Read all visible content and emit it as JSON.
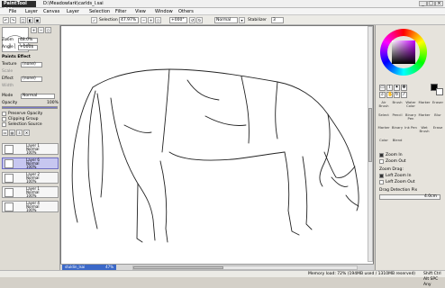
{
  "app": {
    "logo": "PaintTool SAI",
    "title": "D:\\Meadowlark\\carlds_l.sai"
  },
  "window_buttons": {
    "minimize": "_",
    "maximize": "□",
    "close": "×"
  },
  "menu": [
    "File",
    "Layer",
    "Canvas",
    "Layer",
    "Selection",
    "Filter",
    "View",
    "Window",
    "Others"
  ],
  "toolbar": {
    "selection_label": "Selection",
    "zoom": "47.97%",
    "rotate": "+000°",
    "mode": "Normal",
    "stabilizer_label": "Stabilizer",
    "stabilizer_value": "3"
  },
  "left_panel": {
    "zoom_label": "Zoom",
    "zoom_value": "48.0%",
    "angle_label": "Angle",
    "angle_value": "+000$",
    "paints_effect": "Paints Effect",
    "texture_label": "Texture",
    "texture_value": "(none)",
    "scale_label": "Scale",
    "effect_label": "Effect",
    "effect_value": "(none)",
    "width_label": "Width",
    "mode_label": "Mode",
    "mode_value": "Normal",
    "opacity_label": "Opacity",
    "opacity_value": "100%",
    "preserve_opacity": "Preserve Opacity",
    "clipping_group": "Clipping Group",
    "selection_source": "Selection Source",
    "layers": [
      {
        "name": "Layer 1",
        "mode": "Normal",
        "opacity": "100%"
      },
      {
        "name": "Layer 6",
        "mode": "Normal",
        "opacity": "100%"
      },
      {
        "name": "Layer 2",
        "mode": "Normal",
        "opacity": "100%"
      },
      {
        "name": "Layer 1",
        "mode": "Normal",
        "opacity": "100%"
      },
      {
        "name": "Layer 4",
        "mode": "Normal",
        "opacity": "100%"
      }
    ]
  },
  "right_panel": {
    "tools": [
      "Air Brush",
      "Brush",
      "Water Color",
      "Marker",
      "Eraser",
      "Select",
      "Pencil",
      "Binary Pen",
      "Marker",
      "Blur",
      "Marker",
      "Binary",
      "Ink Pen",
      "Wet Brush",
      "Erase",
      "Color",
      "Blend"
    ],
    "zoom_in": "Zoom In",
    "zoom_out": "Zoom Out",
    "zoom_drag": "Zoom Drag:",
    "left_zoom_in": "Left Zoom In",
    "left_zoom_out": "Left Zoom Out",
    "drag_detection": "Drag Detection Pix",
    "drag_value": "4.0cm"
  },
  "canvas_tab": {
    "name": "stuldin_lsai",
    "zoom": "47%"
  },
  "status": {
    "memory": "Memory load: 72% (194MB used / 1310MB reserved)",
    "keys": "Shift Ctrl Alt SPC Any"
  },
  "colors": {
    "selected_layer": "#c7c7f0",
    "accent": "#3b68c8"
  }
}
